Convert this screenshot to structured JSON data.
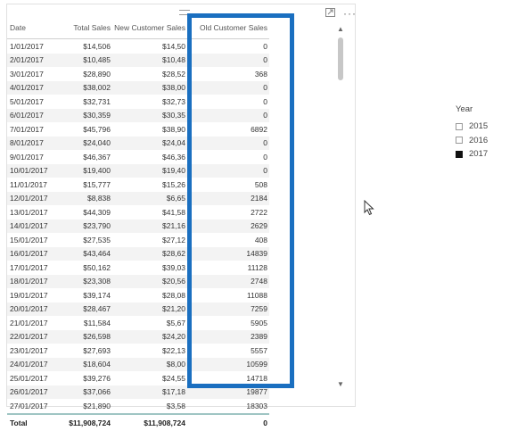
{
  "table": {
    "headers": [
      "Date",
      "Total Sales",
      "New Customer Sales",
      "Old Customer Sales"
    ],
    "rows": [
      [
        "1/01/2017",
        "$14,506",
        "$14,50",
        "0"
      ],
      [
        "2/01/2017",
        "$10,485",
        "$10,48",
        "0"
      ],
      [
        "3/01/2017",
        "$28,890",
        "$28,52",
        "368"
      ],
      [
        "4/01/2017",
        "$38,002",
        "$38,00",
        "0"
      ],
      [
        "5/01/2017",
        "$32,731",
        "$32,73",
        "0"
      ],
      [
        "6/01/2017",
        "$30,359",
        "$30,35",
        "0"
      ],
      [
        "7/01/2017",
        "$45,796",
        "$38,90",
        "6892"
      ],
      [
        "8/01/2017",
        "$24,040",
        "$24,04",
        "0"
      ],
      [
        "9/01/2017",
        "$46,367",
        "$46,36",
        "0"
      ],
      [
        "10/01/2017",
        "$19,400",
        "$19,40",
        "0"
      ],
      [
        "11/01/2017",
        "$15,777",
        "$15,26",
        "508"
      ],
      [
        "12/01/2017",
        "$8,838",
        "$6,65",
        "2184"
      ],
      [
        "13/01/2017",
        "$44,309",
        "$41,58",
        "2722"
      ],
      [
        "14/01/2017",
        "$23,790",
        "$21,16",
        "2629"
      ],
      [
        "15/01/2017",
        "$27,535",
        "$27,12",
        "408"
      ],
      [
        "16/01/2017",
        "$43,464",
        "$28,62",
        "14839"
      ],
      [
        "17/01/2017",
        "$50,162",
        "$39,03",
        "11128"
      ],
      [
        "18/01/2017",
        "$23,308",
        "$20,56",
        "2748"
      ],
      [
        "19/01/2017",
        "$39,174",
        "$28,08",
        "11088"
      ],
      [
        "20/01/2017",
        "$28,467",
        "$21,20",
        "7259"
      ],
      [
        "21/01/2017",
        "$11,584",
        "$5,67",
        "5905"
      ],
      [
        "22/01/2017",
        "$26,598",
        "$24,20",
        "2389"
      ],
      [
        "23/01/2017",
        "$27,693",
        "$22,13",
        "5557"
      ],
      [
        "24/01/2017",
        "$18,604",
        "$8,00",
        "10599"
      ],
      [
        "25/01/2017",
        "$39,276",
        "$24,55",
        "14718"
      ],
      [
        "26/01/2017",
        "$37,066",
        "$17,18",
        "19877"
      ],
      [
        "27/01/2017",
        "$21,890",
        "$3,58",
        "18303"
      ]
    ],
    "total": [
      "Total",
      "$11,908,724",
      "$11,908,724",
      "0"
    ]
  },
  "legend": {
    "title": "Year",
    "items": [
      {
        "label": "2015",
        "checked": false
      },
      {
        "label": "2016",
        "checked": false
      },
      {
        "label": "2017",
        "checked": true
      }
    ]
  },
  "colors": {
    "highlight": "#1a6fc0",
    "total_border": "#9fc5c3"
  }
}
